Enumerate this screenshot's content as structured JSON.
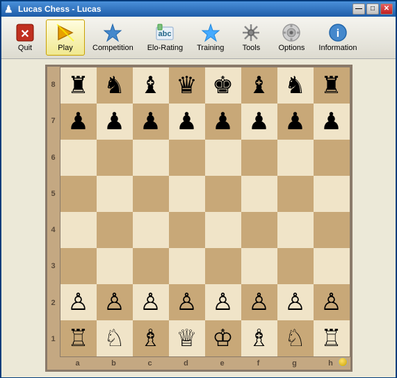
{
  "window": {
    "title": "Lucas Chess - Lucas",
    "icon": "♟"
  },
  "titlebar": {
    "minimize": "—",
    "maximize": "□",
    "close": "✕"
  },
  "toolbar": {
    "buttons": [
      {
        "id": "quit",
        "label": "Quit",
        "icon": "quit"
      },
      {
        "id": "play",
        "label": "Play",
        "icon": "play",
        "active": true
      },
      {
        "id": "competition",
        "label": "Competition",
        "icon": "competition"
      },
      {
        "id": "elo-rating",
        "label": "Elo-Rating",
        "icon": "elo"
      },
      {
        "id": "training",
        "label": "Training",
        "icon": "training"
      },
      {
        "id": "tools",
        "label": "Tools",
        "icon": "tools"
      },
      {
        "id": "options",
        "label": "Options",
        "icon": "options"
      },
      {
        "id": "information",
        "label": "Information",
        "icon": "information"
      }
    ]
  },
  "board": {
    "ranks": [
      "8",
      "7",
      "6",
      "5",
      "4",
      "3",
      "2",
      "1"
    ],
    "files": [
      "a",
      "b",
      "c",
      "d",
      "e",
      "f",
      "g",
      "h"
    ],
    "pieces": {
      "a8": "♜",
      "b8": "♞",
      "c8": "♝",
      "d8": "♛",
      "e8": "♚",
      "f8": "♝",
      "g8": "♞",
      "h8": "♜",
      "a7": "♟",
      "b7": "♟",
      "c7": "♟",
      "d7": "♟",
      "e7": "♟",
      "f7": "♟",
      "g7": "♟",
      "h7": "♟",
      "a2": "♙",
      "b2": "♙",
      "c2": "♙",
      "d2": "♙",
      "e2": "♙",
      "f2": "♙",
      "g2": "♙",
      "h2": "♙",
      "a1": "♖",
      "b1": "♘",
      "c1": "♗",
      "d1": "♕",
      "e1": "♔",
      "f1": "♗",
      "g1": "♘",
      "h1": "♖"
    }
  }
}
